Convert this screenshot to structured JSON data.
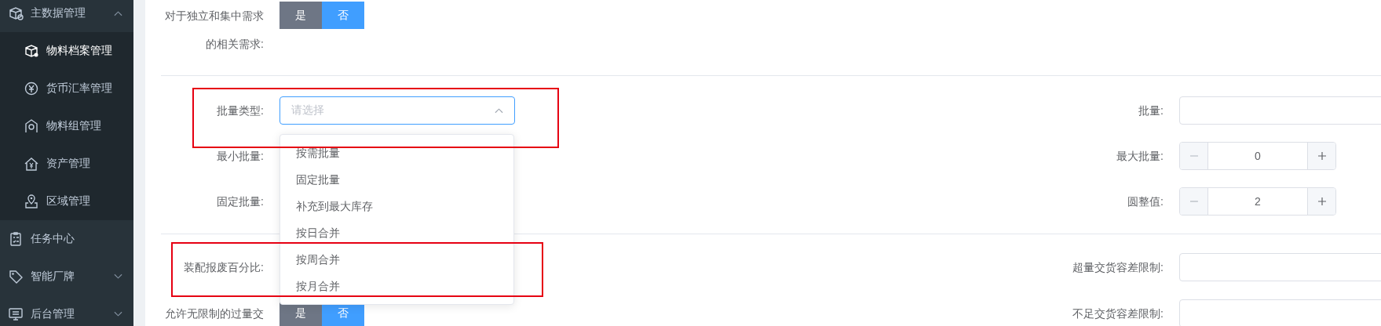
{
  "sidebar": {
    "items": [
      {
        "label": "主数据管理",
        "kind": "group",
        "expanded": true,
        "children": [
          {
            "label": "物料档案管理",
            "selected": true
          },
          {
            "label": "货币汇率管理",
            "selected": false
          },
          {
            "label": "物料组管理",
            "selected": false
          },
          {
            "label": "资产管理",
            "selected": false
          },
          {
            "label": "区域管理",
            "selected": false
          }
        ]
      },
      {
        "label": "任务中心",
        "kind": "leaf"
      },
      {
        "label": "智能厂牌",
        "kind": "group",
        "expanded": false
      },
      {
        "label": "后台管理",
        "kind": "group",
        "expanded": false
      }
    ]
  },
  "form": {
    "sections": [
      {
        "rows": [
          {
            "left": {
              "label": "对于独立和集中需求的相关需求:",
              "kind": "toggle",
              "highlighted": false,
              "options": [
                {
                  "label": "是",
                  "selected": false
                },
                {
                  "label": "否",
                  "selected": true
                }
              ]
            }
          }
        ]
      },
      {
        "rows": [
          {
            "left": {
              "label": "批量类型:",
              "kind": "select",
              "highlighted": true,
              "placeholder": "请选择",
              "open": true,
              "options": [
                "按需批量",
                "固定批量",
                "补充到最大库存",
                "按日合并",
                "按周合并",
                "按月合并"
              ]
            },
            "right": {
              "label": "批量:",
              "kind": "input"
            }
          },
          {
            "left": {
              "label": "最小批量:",
              "highlighted": false
            },
            "right": {
              "label": "最大批量:",
              "kind": "stepper",
              "value": "0"
            }
          },
          {
            "left": {
              "label": "固定批量:",
              "highlighted": false
            },
            "right": {
              "label": "圆整值:",
              "kind": "stepper",
              "value": "2"
            }
          }
        ]
      },
      {
        "rows": [
          {
            "left": {
              "label": "装配报废百分比:",
              "highlighted": true
            },
            "right": {
              "label": "超量交货容差限制:",
              "kind": "input"
            }
          },
          {
            "left": {
              "label": "允许无限制的过量交",
              "kind": "toggle",
              "highlighted": false,
              "options": [
                {
                  "label": "是",
                  "selected": false
                },
                {
                  "label": "否",
                  "selected": true
                }
              ]
            },
            "right": {
              "label": "不足交货容差限制:",
              "kind": "input"
            }
          }
        ]
      }
    ]
  }
}
